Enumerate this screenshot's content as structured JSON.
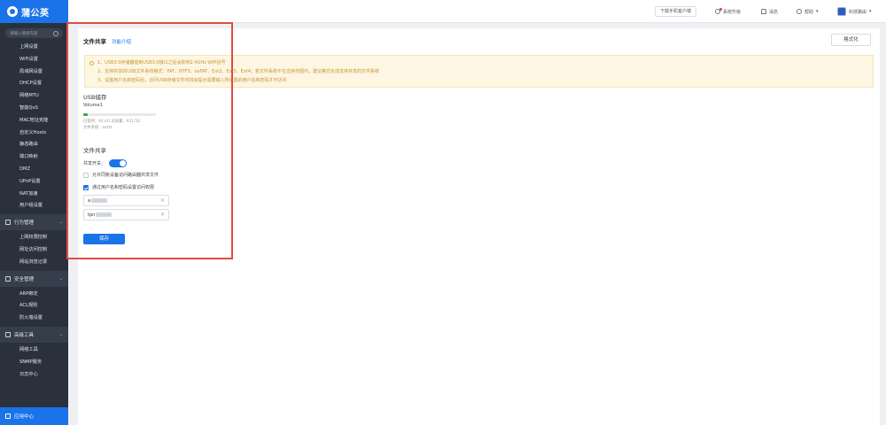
{
  "brand": {
    "name": "蒲公英"
  },
  "sidebar": {
    "search_placeholder": "请输入搜索内容",
    "net_items": [
      "上网设置",
      "WiFi设置",
      "局域网设置",
      "DHCP设置",
      "网络MTU",
      "智能QoS",
      "MAC地址克隆",
      "自定义Hosts",
      "静态路由",
      "端口映射",
      "DMZ",
      "UPnP设置",
      "NAT加速",
      "用户组设置"
    ],
    "group_behavior": "行为管理",
    "behavior_items": [
      "上网权限控制",
      "网址访问控制",
      "网站浏览记录"
    ],
    "group_security": "安全管理",
    "security_items": [
      "ARP绑定",
      "ACL规则",
      "防火墙设置"
    ],
    "group_tools": "高级工具",
    "tools_items": [
      "网络工具",
      "SNMP服务",
      "日志中心"
    ],
    "bottom_label": "应用中心"
  },
  "topbar": {
    "download_app": "下载手机客户端",
    "system_upgrade": "系统升级",
    "notifications": "消息",
    "help": "帮助",
    "account": "科技路由"
  },
  "page": {
    "title": "文件共享",
    "intro_link": "功能介绍",
    "format_button": "格式化"
  },
  "notice": {
    "line1": "1、USB3.0存储器插到USB3.0接口之后会影响2.4GHz WiFi信号",
    "line2": "2、支持共享的USB文件系统格式：FAT、NTFS、exFAT、Ext2、Ext3、Ext4；若文件系统不在支持范围内，建议格式化成支持共享的文件系统",
    "line3": "3、设置用户名和密码后，访问USB存储文件时将会提示需要输入所设置的用户名和密码才可访问"
  },
  "usb": {
    "section_title": "USB储存",
    "volume": "Volume1",
    "used_percent": 6,
    "capacity_text": "已使用：92.4G   总容量：931.5G",
    "fs_text": "文件系统：exfat"
  },
  "share": {
    "section_title": "文件共享",
    "toggle_label": "共享开关：",
    "toggle_on": true,
    "anonymous_label": "允许同账设备访问路由器共享文件",
    "anonymous_checked": false,
    "auth_label": "通过用户名和密码设置访问权限",
    "auth_checked": true,
    "username_prefix": "a",
    "password_prefix": "tpn",
    "save_button": "保存"
  },
  "colors": {
    "accent": "#1a73e8",
    "sidebar": "#2a313d",
    "highlight": "#e04b3f",
    "notice_text": "#c9952f"
  }
}
